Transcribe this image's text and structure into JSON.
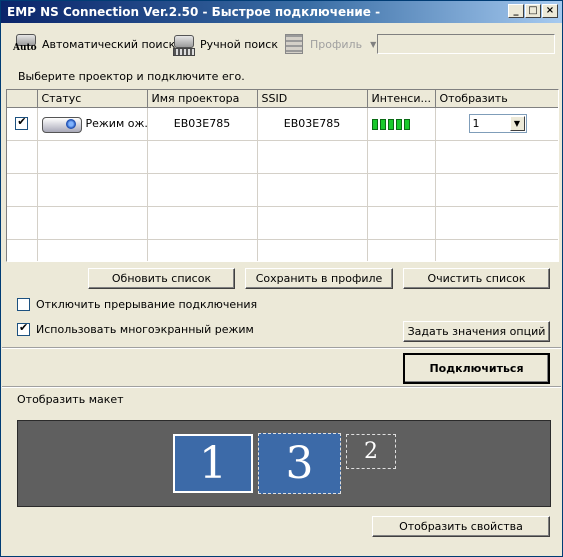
{
  "window": {
    "title": "EMP NS Connection Ver.2.50 - Быстрое подключение -",
    "controls": [
      "_",
      "□",
      "×"
    ]
  },
  "toolbar": {
    "auto_search": {
      "label": "Автоматический поиск",
      "icon": "auto-search-icon"
    },
    "manual_search": {
      "label": "Ручной поиск",
      "icon": "manual-search-icon"
    },
    "profile": {
      "label": "Профиль",
      "icon": "profile-icon",
      "disabled": true
    },
    "profile_combo_value": ""
  },
  "instruction": "Выберите проектор и подключите его.",
  "table": {
    "columns": [
      "",
      "Статус",
      "Имя проектора",
      "SSID",
      "Интенси...",
      "Отобразить"
    ],
    "rows": [
      {
        "checked": true,
        "icon": "projector-icon",
        "status": "Режим ож...",
        "projector_name": "EB03E785",
        "ssid": "EB03E785",
        "signal_bars": 5,
        "display": "1"
      }
    ],
    "empty_rows": 4
  },
  "buttons": {
    "refresh": "Обновить список",
    "save_profile": "Сохранить в профиле",
    "clear": "Очистить список",
    "set_options": "Задать значения опций",
    "connect": "Подключиться",
    "display_properties": "Отобразить свойства"
  },
  "options": {
    "disable_interrupt": {
      "label": "Отключить прерывание подключения",
      "checked": false
    },
    "multiscreen": {
      "label": "Использовать многоэкранный режим",
      "checked": true
    }
  },
  "layout": {
    "label": "Отобразить макет",
    "screens": [
      "1",
      "3",
      "2"
    ]
  },
  "colors": {
    "title_bar_start": "#0a246a",
    "window_bg": "#ece9d8",
    "screen_blue": "#3c6aa8",
    "signal_green": "#19c92b",
    "layout_bg": "#5f5f5f"
  }
}
